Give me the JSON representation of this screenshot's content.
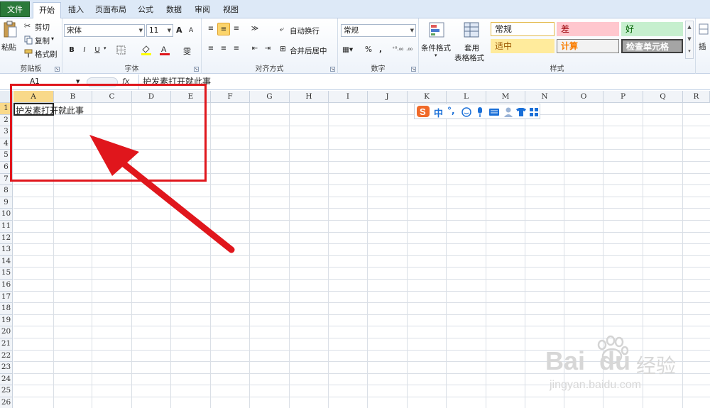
{
  "tabs": [
    "文件",
    "开始",
    "插入",
    "页面布局",
    "公式",
    "数据",
    "审阅",
    "视图"
  ],
  "active_tab": "开始",
  "clipboard": {
    "paste": "粘贴",
    "cut": "剪切",
    "copy": "复制",
    "copy_dd": "▾",
    "format_painter": "格式刷",
    "label": "剪贴板"
  },
  "font": {
    "name": "宋体",
    "size": "11",
    "grow": "A",
    "shrink": "A",
    "bold": "B",
    "italic": "I",
    "underline": "U",
    "label": "字体",
    "phonetic": "雯"
  },
  "alignment": {
    "wrap": "自动换行",
    "merge": "合并后居中",
    "label": "对齐方式"
  },
  "number": {
    "format": "常规",
    "percent": "%",
    "comma": ",",
    "inc_dec": "⁺⁰₀",
    "dec_dec": "⁰₀",
    "label": "数字"
  },
  "styles": {
    "conditional": "条件格式",
    "table_fmt_1": "套用",
    "table_fmt_2": "表格格式",
    "normal": "常规",
    "bad": "差",
    "good": "好",
    "neutral": "适中",
    "calc": "计算",
    "check": "检查单元格",
    "label": "样式"
  },
  "insert_partial": "插",
  "formula_bar": {
    "name_box": "A1",
    "fx": "fx",
    "content": "护发素打开就此事"
  },
  "columns": [
    "A",
    "B",
    "C",
    "D",
    "E",
    "F",
    "G",
    "H",
    "I",
    "J",
    "K",
    "L",
    "M",
    "N",
    "O",
    "P",
    "Q",
    "R"
  ],
  "rows": [
    "1",
    "2",
    "3",
    "4",
    "5",
    "6",
    "7",
    "8",
    "9",
    "10",
    "11",
    "12",
    "13",
    "14",
    "15",
    "16",
    "17",
    "18",
    "19",
    "20",
    "21",
    "22",
    "23",
    "24",
    "25",
    "26"
  ],
  "active_cell": "A1",
  "cell_A1": "护发素打开就此事",
  "ime": {
    "mode": "中",
    "punct": "°,"
  },
  "watermark": {
    "brand": "Bai",
    "brand2": "du",
    "cn": "经验",
    "url": "jingyan.baidu.com"
  },
  "colors": {
    "accent_red": "#e0161c",
    "file_tab": "#2b7a3a",
    "selection": "#f9d98a"
  }
}
